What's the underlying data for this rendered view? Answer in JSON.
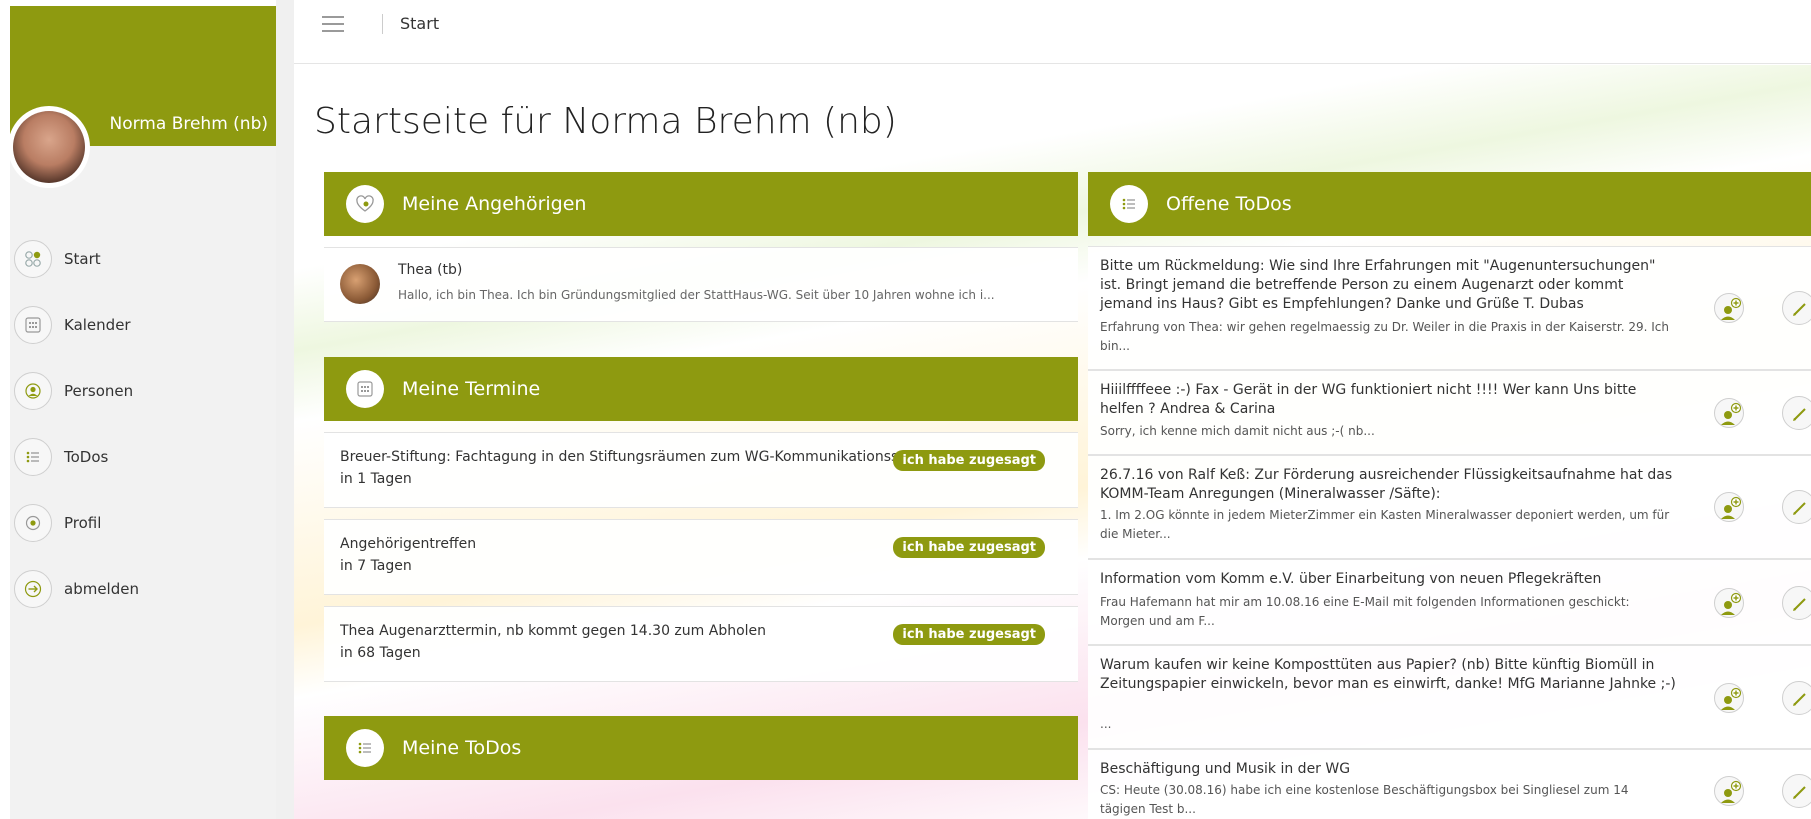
{
  "user": {
    "name": "Norma Brehm (nb)"
  },
  "nav": [
    {
      "label": "Start",
      "icon": "start-icon"
    },
    {
      "label": "Kalender",
      "icon": "calendar-icon"
    },
    {
      "label": "Personen",
      "icon": "person-icon"
    },
    {
      "label": "ToDos",
      "icon": "list-icon"
    },
    {
      "label": "Profil",
      "icon": "profile-icon"
    },
    {
      "label": "abmelden",
      "icon": "logout-icon"
    }
  ],
  "breadcrumb": {
    "current": "Start"
  },
  "page": {
    "title": "Startseite für Norma Brehm (nb)"
  },
  "angehoerige": {
    "title": "Meine Angehörigen",
    "member": {
      "name": "Thea (tb)",
      "desc": "Hallo, ich bin Thea. Ich bin Gründungsmitglied der StattHaus-WG. Seit über 10 Jahren wohne ich i..."
    }
  },
  "termine": {
    "title": "Meine Termine",
    "items": [
      {
        "title": "Breuer-Stiftung: Fachtagung in den Stiftungsräumen zum WG-Kommunikationss",
        "when": "in 1 Tagen",
        "badge": "ich habe zugesagt"
      },
      {
        "title": "Angehörigentreffen",
        "when": "in 7 Tagen",
        "badge": "ich habe zugesagt"
      },
      {
        "title": "Thea Augenarzttermin, nb kommt gegen 14.30 zum Abholen",
        "when": "in 68 Tagen",
        "badge": "ich habe zugesagt"
      }
    ]
  },
  "meine_todos": {
    "title": "Meine ToDos"
  },
  "offene_todos": {
    "title": "Offene ToDos",
    "items": [
      {
        "title": "Bitte um Rückmeldung: Wie sind Ihre Erfahrungen mit \"Augenuntersuchungen\" ist. Bringt jemand die betreffende Person zu einem Augenarzt oder kommt jemand ins Haus? Gibt es Empfehlungen? Danke und Grüße T. Dubas",
        "desc": "Erfahrung von Thea: wir gehen regelmaessig zu Dr. Weiler in die Praxis in der Kaiserstr. 29. Ich bin..."
      },
      {
        "title": "Hiiilffffeee :-) Fax - Gerät in der WG funktioniert nicht !!!! Wer kann Uns bitte helfen ? Andrea & Carina",
        "desc": "Sorry, ich kenne mich damit nicht aus ;-( nb..."
      },
      {
        "title": "26.7.16 von Ralf Keß: Zur Förderung ausreichender Flüssigkeitsaufnahme hat das KOMM-Team Anregungen (Mineralwasser /Säfte):",
        "desc": "1. Im 2.OG könnte in jedem MieterZimmer ein Kasten Mineralwasser deponiert werden, um für die Mieter..."
      },
      {
        "title": "Information vom Komm e.V. über Einarbeitung von neuen Pflegekräften",
        "desc": "Frau Hafemann hat mir am 10.08.16 eine E-Mail mit folgenden Informationen geschickt: Morgen und am F..."
      },
      {
        "title": "Warum kaufen wir keine Komposttüten aus Papier? (nb) Bitte künftig Biomüll in Zeitungspapier einwickeln, bevor man es einwirft, danke! MfG Marianne Jahnke ;-)",
        "desc": "..."
      },
      {
        "title": "Beschäftigung und Musik in der WG",
        "desc": "CS: Heute (30.08.16) habe ich eine kostenlose Beschäftigungsbox bei Singliesel zum 14 tägigen Test b..."
      }
    ]
  },
  "colors": {
    "accent": "#8e9a10"
  }
}
